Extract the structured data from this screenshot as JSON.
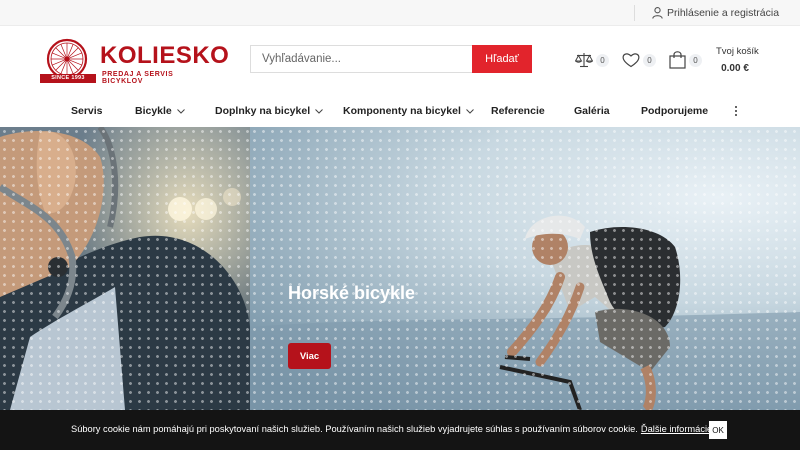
{
  "topbar": {
    "login_label": "Prihlásenie a registrácia",
    "user_icon": "user-icon"
  },
  "logo": {
    "brand": "KOLIESKO",
    "tagline": "PREDAJ A SERVIS BICYKLOV",
    "since": "SINCE 1993",
    "icon": "bicycle-wheel-icon"
  },
  "search": {
    "placeholder": "Vyhľadávanie...",
    "value": "",
    "button_label": "Hľadať"
  },
  "header_icons": {
    "compare": {
      "icon": "scale-icon",
      "count": "0"
    },
    "wishlist": {
      "icon": "heart-icon",
      "count": "0"
    },
    "cart": {
      "icon": "shopping-bag-icon",
      "count": "0",
      "label": "Tvoj košík",
      "total": "0.00 €"
    }
  },
  "nav": {
    "items": [
      {
        "label": "Servis",
        "has_dropdown": false
      },
      {
        "label": "Bicykle",
        "has_dropdown": true
      },
      {
        "label": "Doplnky na bicykel",
        "has_dropdown": true
      },
      {
        "label": "Komponenty na bicykel",
        "has_dropdown": true
      },
      {
        "label": "Referencie",
        "has_dropdown": false
      },
      {
        "label": "Galéria",
        "has_dropdown": false
      },
      {
        "label": "Podporujeme",
        "has_dropdown": false
      }
    ],
    "more_icon": "more-vertical-icon"
  },
  "hero": {
    "title": "Horské bicykle",
    "button_label": "Viac"
  },
  "cookie": {
    "text": "Súbory cookie nám pomáhajú pri poskytovaní našich služieb. Používaním našich služieb vyjadrujete súhlas s používaním súborov cookie.",
    "link_label": "Ďalšie informácie.",
    "ok_label": "OK"
  },
  "colors": {
    "brand_red": "#b5121b",
    "search_button_red": "#e2242c",
    "cookie_bar": "#141414"
  }
}
